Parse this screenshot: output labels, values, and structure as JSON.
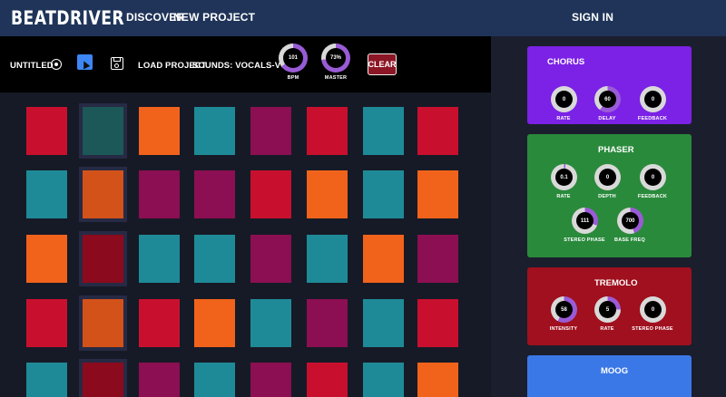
{
  "nav": {
    "brand": "BEATDRIVER",
    "discover": "DISCOVER",
    "new_project": "NEW PROJECT",
    "sign_in": "SIGN IN"
  },
  "toolbar": {
    "project_title": "UNTITLED",
    "load_project": "LOAD PROJECT",
    "sounds": "SOUNDS:  VOCALS-VOX-5",
    "bpm": {
      "value": "101",
      "label": "BPM",
      "fraction": 0.65
    },
    "master": {
      "value": "73%",
      "label": "MASTER",
      "fraction": 0.73
    },
    "clear": "CLEAR",
    "icons": [
      "record-icon",
      "cursor-icon",
      "save-icon"
    ]
  },
  "colors": {
    "red": "#c8102e",
    "teal": "#1f8a97",
    "orange": "#f1631b",
    "magenta": "#8b0f52",
    "dark_teal": "#1d5858",
    "burnt": "#d35219",
    "maroon": "#8c0a1d",
    "knob_purple": "#9a5bd6",
    "knob_grey": "#d9d9d9"
  },
  "pads": [
    [
      "red",
      "dark_teal",
      "orange",
      "teal",
      "magenta",
      "red",
      "teal",
      "red"
    ],
    [
      "teal",
      "burnt",
      "magenta",
      "magenta",
      "red",
      "orange",
      "teal",
      "orange"
    ],
    [
      "orange",
      "maroon",
      "teal",
      "teal",
      "magenta",
      "teal",
      "orange",
      "magenta"
    ],
    [
      "red",
      "burnt",
      "red",
      "orange",
      "teal",
      "magenta",
      "teal",
      "red"
    ],
    [
      "teal",
      "maroon",
      "magenta",
      "teal",
      "magenta",
      "red",
      "teal",
      "orange"
    ]
  ],
  "active_pads": [
    [
      0,
      1
    ],
    [
      1,
      1
    ],
    [
      2,
      1
    ],
    [
      3,
      1
    ],
    [
      4,
      1
    ]
  ],
  "effects": [
    {
      "title": "CHORUS",
      "color": "#7b22e6",
      "knobs": [
        {
          "value": "0",
          "label": "RATE",
          "fraction": 0.0
        },
        {
          "value": "60",
          "label": "DELAY",
          "fraction": 0.6
        },
        {
          "value": "0",
          "label": "FEEDBACK",
          "fraction": 0.0
        }
      ]
    },
    {
      "title": "PHASER",
      "color": "#2a8a3c",
      "knobs": [
        {
          "value": "0.1",
          "label": "RATE",
          "fraction": 0.02
        },
        {
          "value": "0",
          "label": "DEPTH",
          "fraction": 0.0
        },
        {
          "value": "0",
          "label": "FEEDBACK",
          "fraction": 0.0
        },
        {
          "value": "111",
          "label": "STEREO PHASE",
          "fraction": 0.31
        },
        {
          "value": "700",
          "label": "BASE FREQ",
          "fraction": 0.45
        }
      ]
    },
    {
      "title": "TREMOLO",
      "color": "#a0101e",
      "knobs": [
        {
          "value": "58",
          "label": "INTENSITY",
          "fraction": 0.58
        },
        {
          "value": "5",
          "label": "RATE",
          "fraction": 0.25
        },
        {
          "value": "0",
          "label": "STEREO PHASE",
          "fraction": 0.0
        }
      ]
    },
    {
      "title": "MOOG",
      "color": "#3b78e7",
      "knobs": []
    }
  ]
}
